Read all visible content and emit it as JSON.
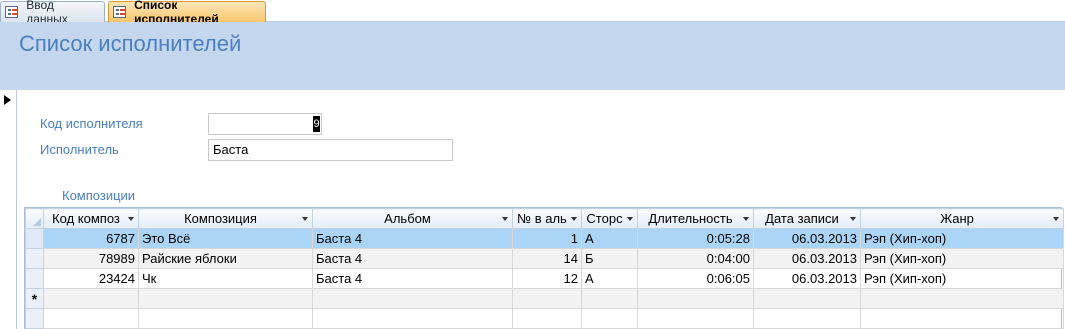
{
  "tabs": [
    {
      "label": "Ввод данных",
      "active": false
    },
    {
      "label": "Список исполнителей",
      "active": true
    }
  ],
  "form": {
    "title": "Список исполнителей",
    "code_label": "Код исполнителя",
    "code_value": "9",
    "artist_label": "Исполнитель",
    "artist_value": "Баста",
    "subform_label": "Композиции"
  },
  "subform": {
    "columns": [
      "Код композ",
      "Композиция",
      "Альбом",
      "№ в аль",
      "Сторс",
      "Длительность",
      "Дата записи",
      "Жанр"
    ],
    "rows": [
      [
        "6787",
        "Это Всё",
        "Баста 4",
        "1",
        "А",
        "0:05:28",
        "06.03.2013",
        "Рэп (Хип-хоп)"
      ],
      [
        "78989",
        "Райские яблоки",
        "Баста 4",
        "14",
        "Б",
        "0:04:00",
        "06.03.2013",
        "Рэп (Хип-хоп)"
      ],
      [
        "23424",
        "Чк",
        "Баста 4",
        "12",
        "А",
        "0:06:05",
        "06.03.2013",
        "Рэп (Хип-хоп)"
      ]
    ],
    "new_row_marker": "*"
  },
  "colors": {
    "header_band": "#c5d7ef",
    "title": "#4a7fc1",
    "active_tab": "#f9c66d",
    "selected_row": "#abd5f7"
  }
}
